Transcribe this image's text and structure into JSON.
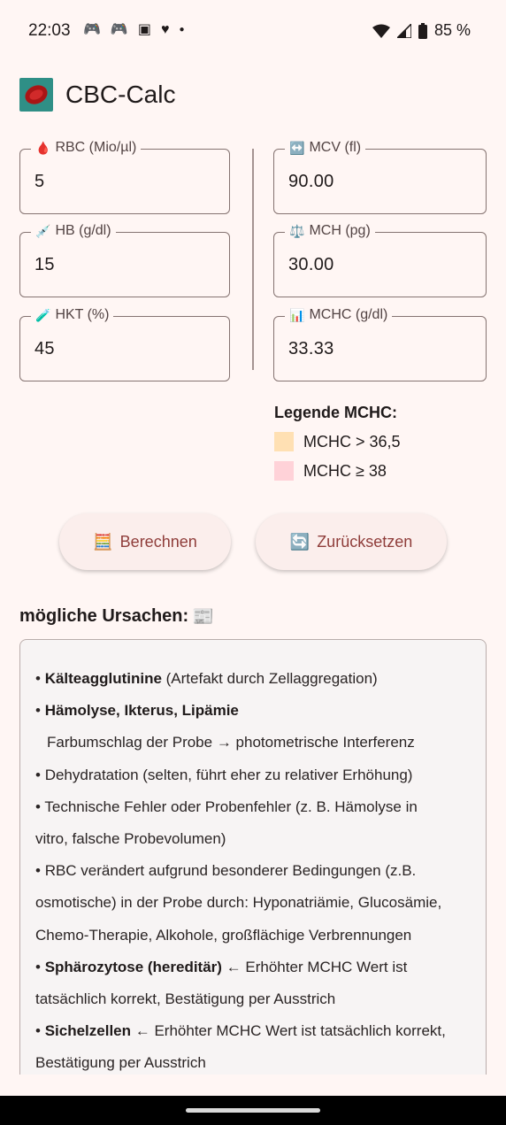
{
  "status": {
    "time": "22:03",
    "icons": [
      "controller-icon",
      "controller-icon",
      "twitch-icon",
      "heart-icon",
      "dot"
    ],
    "battery": "85 %"
  },
  "app": {
    "title": "CBC-Calc"
  },
  "inputs": {
    "rbc": {
      "icon": "🩸",
      "label": "RBC (Mio/µl)",
      "value": "5"
    },
    "hb": {
      "icon": "💉",
      "label": "HB (g/dl)",
      "value": "15"
    },
    "hkt": {
      "icon": "🧪",
      "label": "HKT (%)",
      "value": "45"
    }
  },
  "outputs": {
    "mcv": {
      "icon": "↔️",
      "label": "MCV (fl)",
      "value": "90.00"
    },
    "mch": {
      "icon": "⚖️",
      "label": "MCH (pg)",
      "value": "30.00"
    },
    "mchc": {
      "icon": "📊",
      "label": "MCHC (g/dl)",
      "value": "33.33"
    }
  },
  "legend": {
    "title": "Legende MCHC:",
    "items": [
      {
        "label": "MCHC > 36,5",
        "color": "#ffe0b3"
      },
      {
        "label": "MCHC ≥ 38",
        "color": "#ffd2d8"
      }
    ]
  },
  "buttons": {
    "calculate": {
      "icon": "🧮",
      "label": "Berechnen"
    },
    "reset": {
      "icon": "🔄",
      "label": "Zurücksetzen"
    }
  },
  "causes": {
    "title": "mögliche Ursachen:",
    "title_icon": "📰",
    "lines": [
      {
        "bold": "Kälteagglutinine",
        "text": " (Artefakt durch Zellaggregation)"
      },
      {
        "bold": "Hämolyse, Ikterus, Lipämie",
        "text": ""
      },
      {
        "bold": "",
        "text": "Farbumschlag der Probe → photometrische Interferenz",
        "indent": true
      },
      {
        "bold": "",
        "text": "Dehydratation (selten, führt eher zu relativer Erhöhung)"
      },
      {
        "bold": "",
        "text": "Technische Fehler oder Probenfehler (z. B. Hämolyse in"
      },
      {
        "bold": "",
        "text": "vitro, falsche Probevolumen)",
        "cont": true
      },
      {
        "bold": "",
        "text": "RBC verändert aufgrund besonderer Bedingungen (z.B."
      },
      {
        "bold": "",
        "text": "osmotische) in der Probe durch: Hyponatriämie, Glucosämie,",
        "cont": true
      },
      {
        "bold": "",
        "text": "Chemo-Therapie, Alkohole, großflächige Verbrennungen",
        "cont": true
      },
      {
        "bold": "Sphärozytose (hereditär)",
        "text": " ← Erhöhter MCHC Wert ist"
      },
      {
        "bold": "",
        "text": "tatsächlich korrekt, Bestätigung per Ausstrich",
        "cont": true
      },
      {
        "bold": "Sichelzellen",
        "text": " ← Erhöhter MCHC Wert ist tatsächlich korrekt,"
      },
      {
        "bold": "",
        "text": "Bestätigung per Ausstrich",
        "cont": true
      }
    ]
  }
}
